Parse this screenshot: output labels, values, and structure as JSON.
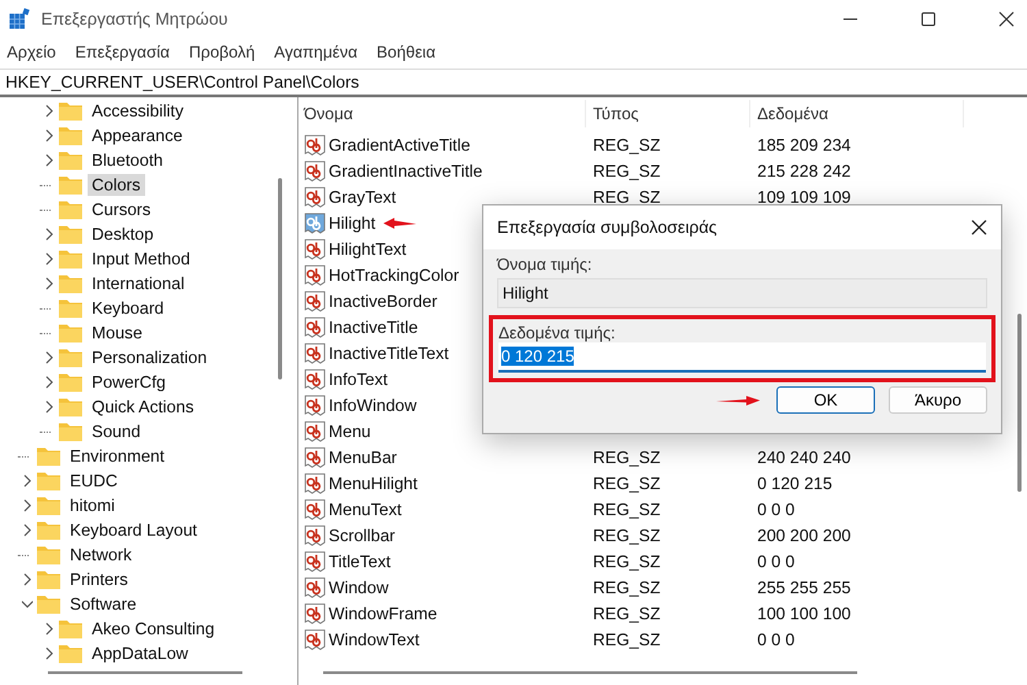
{
  "window": {
    "title": "Επεξεργαστής Μητρώου"
  },
  "menu": [
    "Αρχείο",
    "Επεξεργασία",
    "Προβολή",
    "Αγαπημένα",
    "Βοήθεια"
  ],
  "address": "HKEY_CURRENT_USER\\Control Panel\\Colors",
  "tree": {
    "partial_group": [
      {
        "label": "Accessibility",
        "expandable": true,
        "expanded": false,
        "selected": false
      },
      {
        "label": "Appearance",
        "expandable": true,
        "expanded": false,
        "selected": false
      },
      {
        "label": "Bluetooth",
        "expandable": true,
        "expanded": false,
        "selected": false
      },
      {
        "label": "Colors",
        "expandable": false,
        "selected": true
      },
      {
        "label": "Cursors",
        "expandable": false,
        "selected": false
      },
      {
        "label": "Desktop",
        "expandable": true,
        "expanded": false,
        "selected": false
      },
      {
        "label": "Input Method",
        "expandable": true,
        "expanded": false,
        "selected": false
      },
      {
        "label": "International",
        "expandable": true,
        "expanded": false,
        "selected": false
      },
      {
        "label": "Keyboard",
        "expandable": false,
        "selected": false
      },
      {
        "label": "Mouse",
        "expandable": false,
        "selected": false
      },
      {
        "label": "Personalization",
        "expandable": true,
        "expanded": false,
        "selected": false
      },
      {
        "label": "PowerCfg",
        "expandable": true,
        "expanded": false,
        "selected": false
      },
      {
        "label": "Quick Actions",
        "expandable": true,
        "expanded": false,
        "selected": false
      },
      {
        "label": "Sound",
        "expandable": false,
        "selected": false
      }
    ],
    "items": [
      {
        "label": "Environment",
        "expandable": false,
        "selected": false
      },
      {
        "label": "EUDC",
        "expandable": true,
        "expanded": false,
        "selected": false
      },
      {
        "label": "hitomi",
        "expandable": true,
        "expanded": false,
        "selected": false
      },
      {
        "label": "Keyboard Layout",
        "expandable": true,
        "expanded": false,
        "selected": false
      },
      {
        "label": "Network",
        "expandable": false,
        "selected": false
      },
      {
        "label": "Printers",
        "expandable": true,
        "expanded": false,
        "selected": false
      },
      {
        "label": "Software",
        "expandable": true,
        "expanded": true,
        "selected": false,
        "children": [
          {
            "label": "Akeo Consulting",
            "expandable": true,
            "expanded": false,
            "selected": false
          },
          {
            "label": "AppDataLow",
            "expandable": true,
            "expanded": false,
            "selected": false
          }
        ]
      }
    ]
  },
  "table": {
    "columns": [
      "Όνομα",
      "Τύπος",
      "Δεδομένα"
    ],
    "rows": [
      {
        "name": "GradientActiveTitle",
        "type": "REG_SZ",
        "data": "185 209 234",
        "selected": false
      },
      {
        "name": "GradientInactiveTitle",
        "type": "REG_SZ",
        "data": "215 228 242",
        "selected": false
      },
      {
        "name": "GrayText",
        "type": "REG_SZ",
        "data": "109 109 109",
        "selected": false
      },
      {
        "name": "Hilight",
        "selected": true,
        "marked": true
      },
      {
        "name": "HilightText",
        "selected": false
      },
      {
        "name": "HotTrackingColor",
        "selected": false
      },
      {
        "name": "InactiveBorder",
        "selected": false
      },
      {
        "name": "InactiveTitle",
        "selected": false
      },
      {
        "name": "InactiveTitleText",
        "selected": false
      },
      {
        "name": "InfoText",
        "selected": false
      },
      {
        "name": "InfoWindow",
        "selected": false
      },
      {
        "name": "Menu",
        "selected": false
      },
      {
        "name": "MenuBar",
        "type": "REG_SZ",
        "data": "240 240 240",
        "selected": false
      },
      {
        "name": "MenuHilight",
        "type": "REG_SZ",
        "data": "0 120 215",
        "selected": false
      },
      {
        "name": "MenuText",
        "type": "REG_SZ",
        "data": "0 0 0",
        "selected": false
      },
      {
        "name": "Scrollbar",
        "type": "REG_SZ",
        "data": "200 200 200",
        "selected": false
      },
      {
        "name": "TitleText",
        "type": "REG_SZ",
        "data": "0 0 0",
        "selected": false
      },
      {
        "name": "Window",
        "type": "REG_SZ",
        "data": "255 255 255",
        "selected": false
      },
      {
        "name": "WindowFrame",
        "type": "REG_SZ",
        "data": "100 100 100",
        "selected": false
      },
      {
        "name": "WindowText",
        "type": "REG_SZ",
        "data": "0 0 0",
        "selected": false
      }
    ]
  },
  "dialog": {
    "title": "Επεξεργασία συμβολοσειράς",
    "name_label": "Όνομα τιμής:",
    "name_value": "Hilight",
    "data_label": "Δεδομένα τιμής:",
    "data_value": "0 120 215",
    "data_text_selected": true,
    "data_marked": true,
    "buttons": [
      {
        "label": "OK",
        "default": true,
        "marked": true
      },
      {
        "label": "Άκυρο",
        "default": false,
        "marked": false
      }
    ]
  }
}
